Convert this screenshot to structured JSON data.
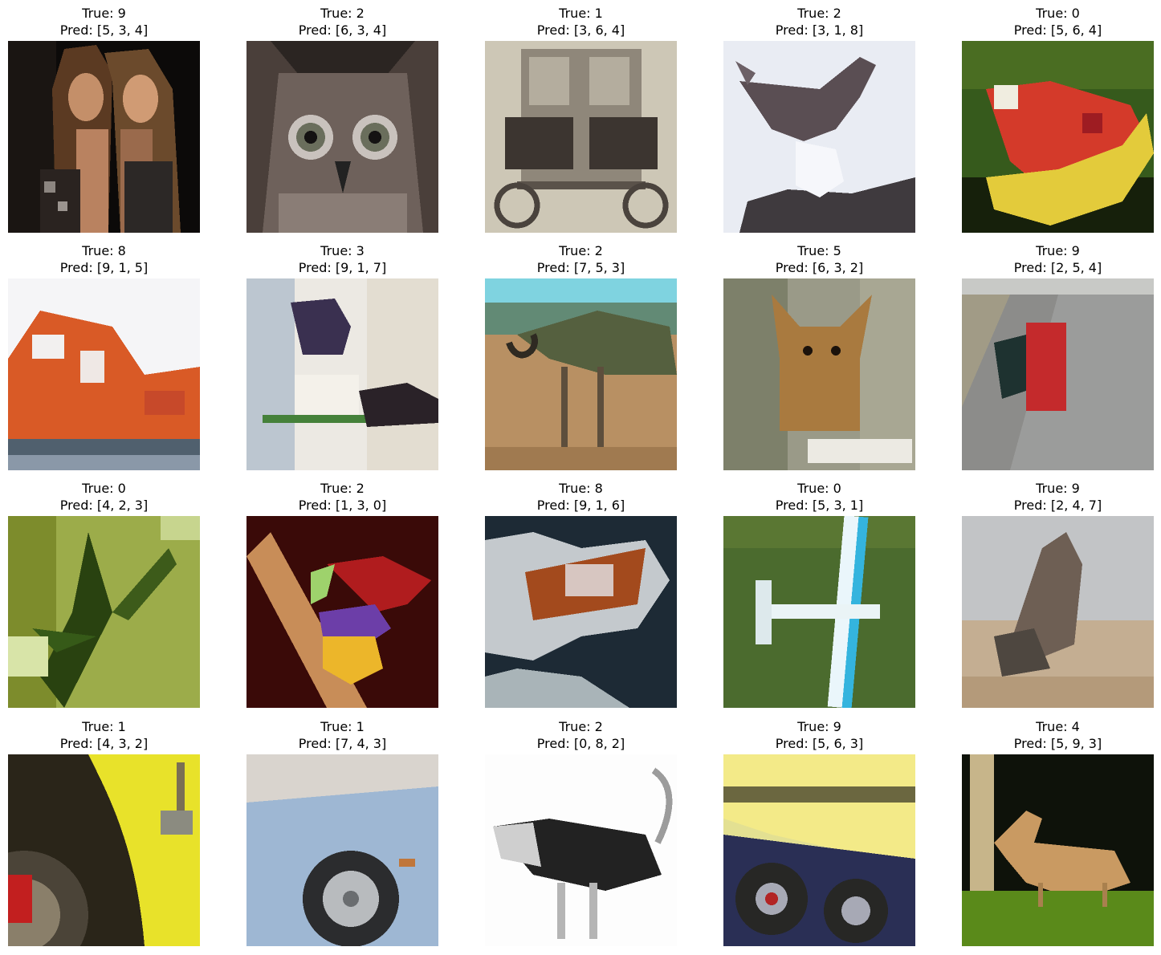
{
  "figure": {
    "panels": [
      {
        "true_label": "True: 9",
        "pred_label": "Pred: [5, 3, 4]",
        "image": "two-women-photo"
      },
      {
        "true_label": "True: 2",
        "pred_label": "Pred: [6, 3, 4]",
        "image": "owl-face-photo"
      },
      {
        "true_label": "True: 1",
        "pred_label": "Pred: [3, 6, 4]",
        "image": "vintage-automobile-photo"
      },
      {
        "true_label": "True: 2",
        "pred_label": "Pred: [3, 1, 8]",
        "image": "bird-reflection-photo"
      },
      {
        "true_label": "True: 0",
        "pred_label": "Pred: [5, 6, 4]",
        "image": "red-yellow-airplane-on-grass-photo"
      },
      {
        "true_label": "True: 8",
        "pred_label": "Pred: [9, 1, 5]",
        "image": "orange-lifeboat-photo"
      },
      {
        "true_label": "True: 3",
        "pred_label": "Pred: [9, 1, 7]",
        "image": "cats-on-furniture-photo"
      },
      {
        "true_label": "True: 2",
        "pred_label": "Pred: [7, 5, 3]",
        "image": "ostrich-in-savanna-photo"
      },
      {
        "true_label": "True: 5",
        "pred_label": "Pred: [6, 3, 2]",
        "image": "chihuahua-dog-photo"
      },
      {
        "true_label": "True: 9",
        "pred_label": "Pred: [2, 5, 4]",
        "image": "red-truck-on-road-photo"
      },
      {
        "true_label": "True: 0",
        "pred_label": "Pred: [4, 2, 3]",
        "image": "plant-leaves-photo"
      },
      {
        "true_label": "True: 2",
        "pred_label": "Pred: [1, 3, 0]",
        "image": "colorful-finch-photo"
      },
      {
        "true_label": "True: 8",
        "pred_label": "Pred: [9, 1, 6]",
        "image": "boat-on-water-photo"
      },
      {
        "true_label": "True: 0",
        "pred_label": "Pred: [5, 3, 1]",
        "image": "airplane-over-grass-photo"
      },
      {
        "true_label": "True: 9",
        "pred_label": "Pred: [2, 4, 7]",
        "image": "rearing-horse-photo"
      },
      {
        "true_label": "True: 1",
        "pred_label": "Pred: [4, 3, 2]",
        "image": "yellow-car-wheel-photo"
      },
      {
        "true_label": "True: 1",
        "pred_label": "Pred: [7, 4, 3]",
        "image": "blue-car-wheel-photo"
      },
      {
        "true_label": "True: 2",
        "pred_label": "Pred: [0, 8, 2]",
        "image": "ostrich-white-background-photo"
      },
      {
        "true_label": "True: 9",
        "pred_label": "Pred: [5, 6, 3]",
        "image": "yellow-truck-wheels-photo"
      },
      {
        "true_label": "True: 4",
        "pred_label": "Pred: [5, 9, 3]",
        "image": "deer-on-grass-photo"
      }
    ]
  }
}
